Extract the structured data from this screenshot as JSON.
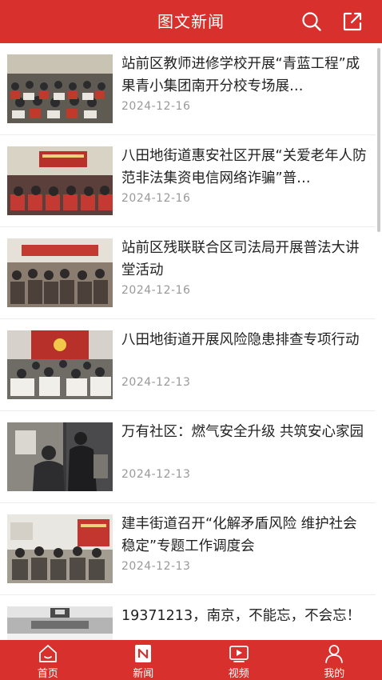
{
  "header": {
    "title": "图文新闻"
  },
  "articles": [
    {
      "title": "站前区教师进修学校开展“青蓝工程”成果青小集团南开分校专场展…",
      "date": "2024-12-16"
    },
    {
      "title": "八田地街道惠安社区开展“关爱老年人防范非法集资电信网络诈骗”普…",
      "date": "2024-12-16"
    },
    {
      "title": "站前区残联联合区司法局开展普法大讲堂活动",
      "date": "2024-12-16"
    },
    {
      "title": "八田地街道开展风险隐患排查专项行动",
      "date": "2024-12-13"
    },
    {
      "title": "万有社区：燃气安全升级 共筑安心家园",
      "date": "2024-12-13"
    },
    {
      "title": "建丰街道召开“化解矛盾风险 维护社会稳定”专题工作调度会",
      "date": "2024-12-13"
    },
    {
      "title": "19371213，南京，不能忘，不会忘！",
      "date": ""
    }
  ],
  "tabbar": {
    "tabs": [
      {
        "label": "首页",
        "icon": "home-icon"
      },
      {
        "label": "新闻",
        "icon": "news-icon"
      },
      {
        "label": "视频",
        "icon": "video-icon"
      },
      {
        "label": "我的",
        "icon": "profile-icon"
      }
    ]
  },
  "colors": {
    "brand": "#d8302c",
    "text": "#222222",
    "date": "#999999"
  }
}
